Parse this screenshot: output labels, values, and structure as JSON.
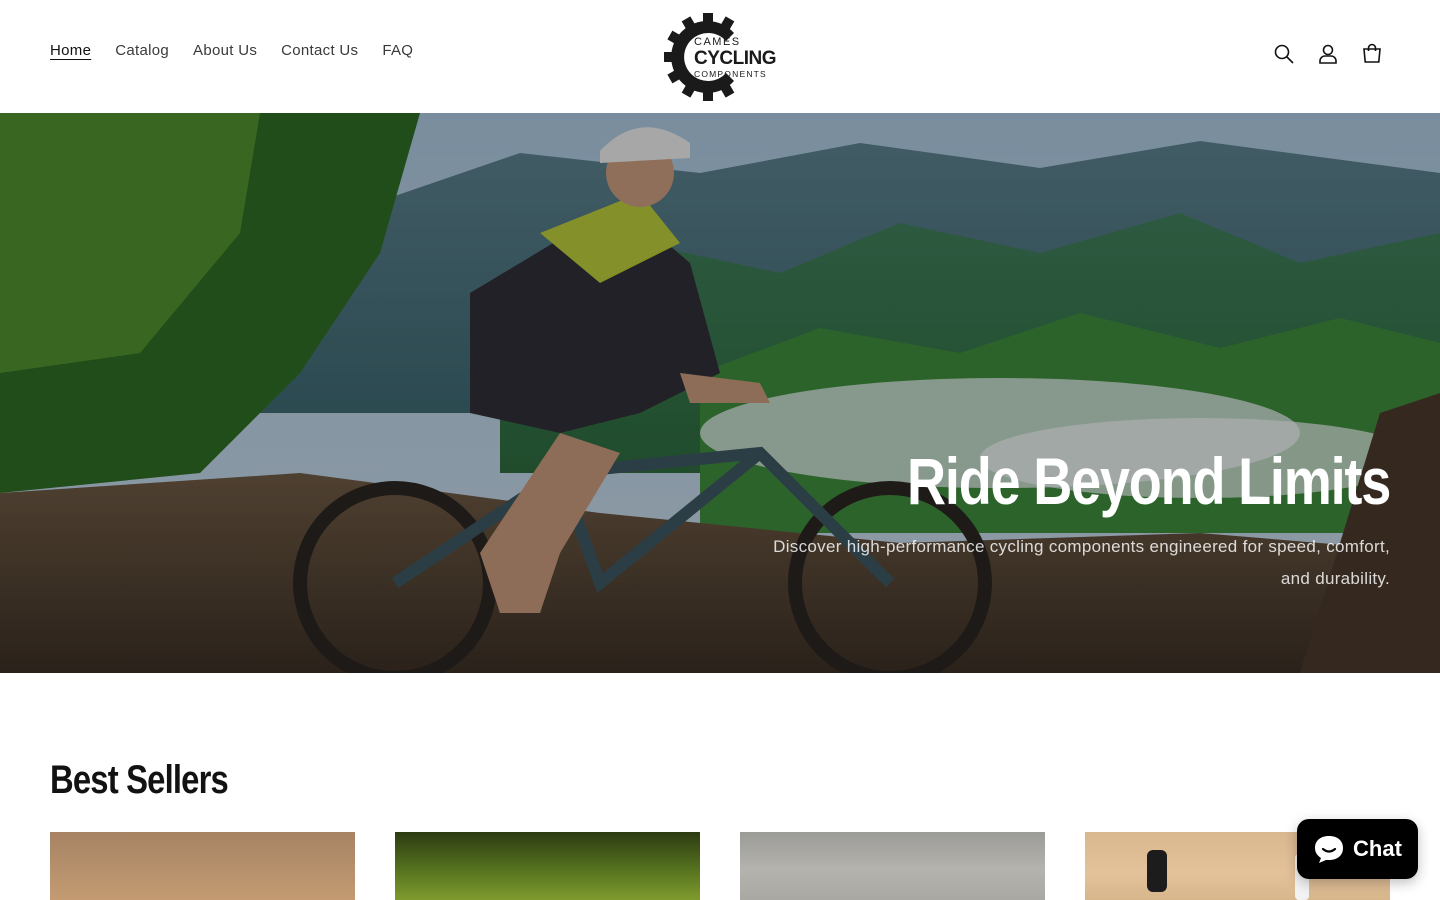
{
  "header": {
    "nav": [
      {
        "label": "Home",
        "active": true
      },
      {
        "label": "Catalog",
        "active": false
      },
      {
        "label": "About Us",
        "active": false
      },
      {
        "label": "Contact Us",
        "active": false
      },
      {
        "label": "FAQ",
        "active": false
      }
    ],
    "logo": {
      "line1": "CAMES",
      "line2": "CYCLING",
      "line3": "COMPONENTS",
      "icon": "gear-logo"
    },
    "icons": [
      "search-icon",
      "account-icon",
      "cart-icon"
    ]
  },
  "hero": {
    "title": "Ride Beyond Limits",
    "subtitle": "Discover high-performance cycling components engineered for speed, comfort, and durability."
  },
  "best_sellers": {
    "title": "Best Sellers"
  },
  "chat": {
    "label": "Chat",
    "icon": "chat-bubble-icon"
  }
}
